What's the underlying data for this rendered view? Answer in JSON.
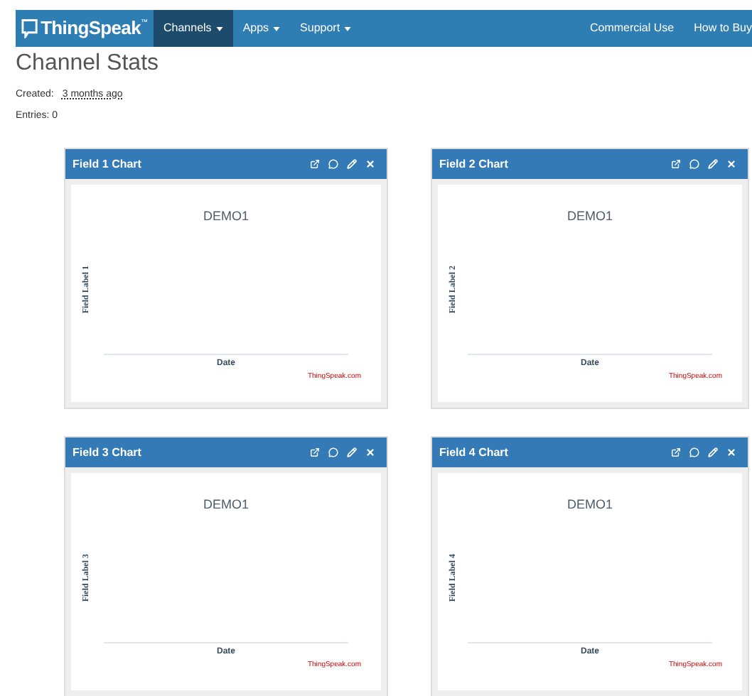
{
  "navbar": {
    "brand": "ThingSpeak",
    "brand_mark": "™",
    "items": [
      {
        "label": "Channels",
        "dropdown": true,
        "selected": true
      },
      {
        "label": "Apps",
        "dropdown": true,
        "selected": false
      },
      {
        "label": "Support",
        "dropdown": true,
        "selected": false
      }
    ],
    "right_items": [
      "Commercial Use",
      "How to Buy"
    ]
  },
  "page": {
    "title": "Channel Stats",
    "created_label": "Created:",
    "created_value": "3 months ago",
    "entries": "Entries: 0"
  },
  "cards": [
    {
      "title": "Field 1 Chart",
      "chart_title": "DEMO1",
      "ylabel": "Field Label 1",
      "xlabel": "Date",
      "credit": "ThingSpeak.com"
    },
    {
      "title": "Field 2 Chart",
      "chart_title": "DEMO1",
      "ylabel": "Field Label 2",
      "xlabel": "Date",
      "credit": "ThingSpeak.com"
    },
    {
      "title": "Field 3 Chart",
      "chart_title": "DEMO1",
      "ylabel": "Field Label 3",
      "xlabel": "Date",
      "credit": "ThingSpeak.com"
    },
    {
      "title": "Field 4 Chart",
      "chart_title": "DEMO1",
      "ylabel": "Field Label 4",
      "xlabel": "Date",
      "credit": "ThingSpeak.com"
    }
  ]
}
